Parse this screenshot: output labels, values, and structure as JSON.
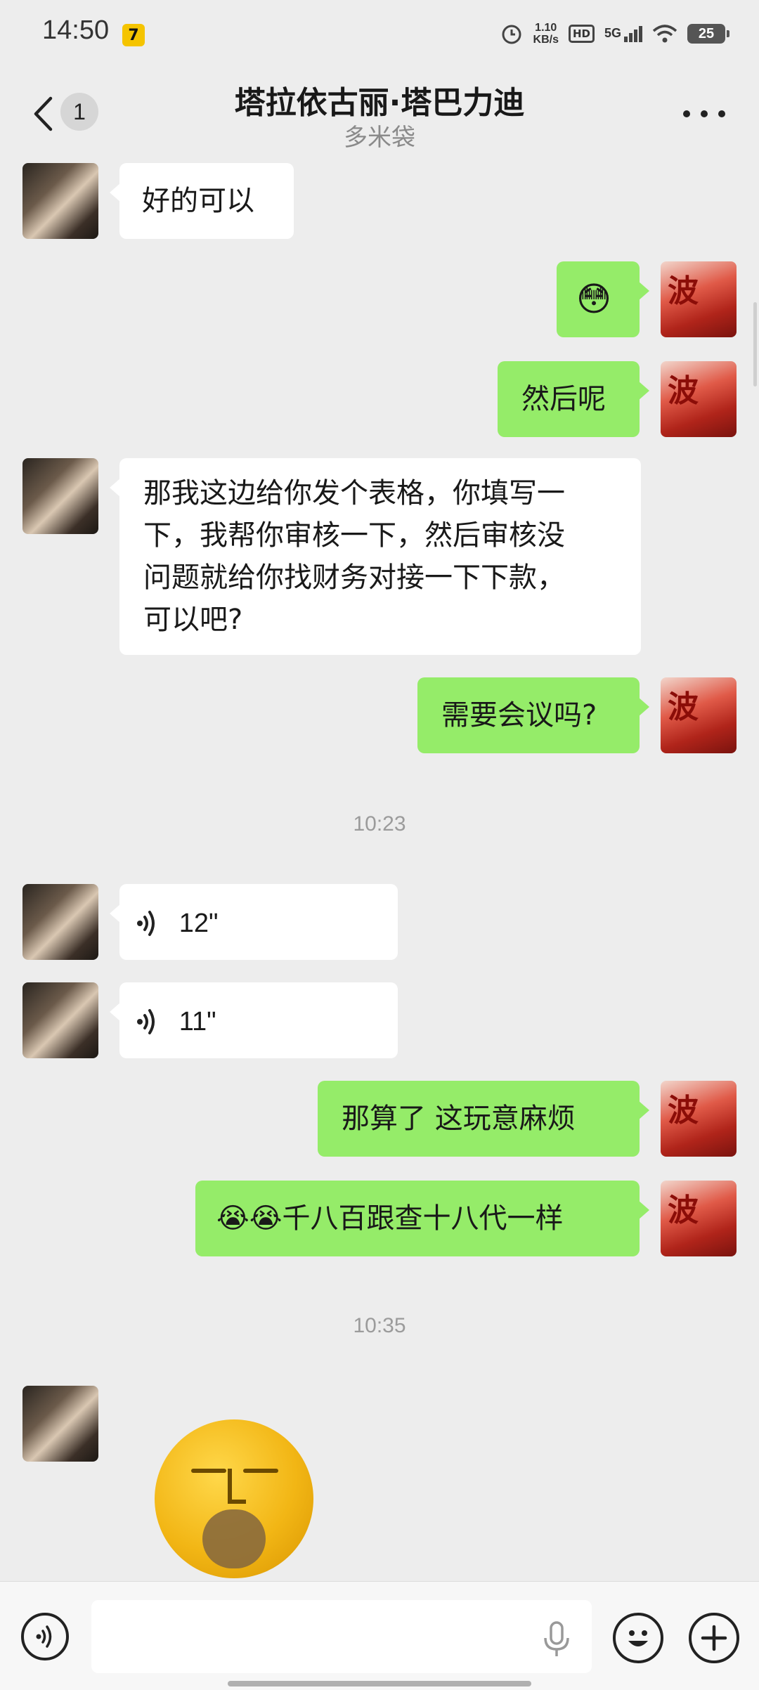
{
  "status_bar": {
    "time": "14:50",
    "app_icon_glyph": "7",
    "speed_value": "1.10",
    "speed_unit": "KB/s",
    "hd_label": "HD",
    "network_label": "5G",
    "battery_level": "25"
  },
  "header": {
    "back_badge": "1",
    "title": "塔拉依古丽·塔巴力迪",
    "subtitle": "多米袋"
  },
  "messages": {
    "m1": {
      "from": "other",
      "text": "好的可以"
    },
    "m2": {
      "from": "me",
      "emoji": "😳"
    },
    "m3": {
      "from": "me",
      "text": "然后呢"
    },
    "m4": {
      "from": "other",
      "line1": "那我这边给你发个表格，你填写一",
      "line2": "下，我帮你审核一下，然后审核没",
      "line3": "问题就给你找财务对接一下下款，",
      "line4": "可以吧?"
    },
    "m5": {
      "from": "me",
      "text": "需要会议吗?"
    },
    "ts1": "10:23",
    "m6": {
      "from": "other",
      "type": "voice",
      "duration": "12\""
    },
    "m7": {
      "from": "other",
      "type": "voice",
      "duration": "11\""
    },
    "m8": {
      "from": "me",
      "text": "那算了 这玩意麻烦"
    },
    "m9": {
      "from": "me",
      "emoji": "😭😭",
      "text": "千八百跟查十八代一样"
    },
    "ts2": "10:35",
    "m10": {
      "from": "other",
      "type": "sticker"
    }
  },
  "my_avatar_glyph": "波",
  "input_bar": {
    "placeholder": ""
  },
  "colors": {
    "background": "#EDEDED",
    "my_bubble": "#95EC69",
    "other_bubble": "#FFFFFF"
  }
}
